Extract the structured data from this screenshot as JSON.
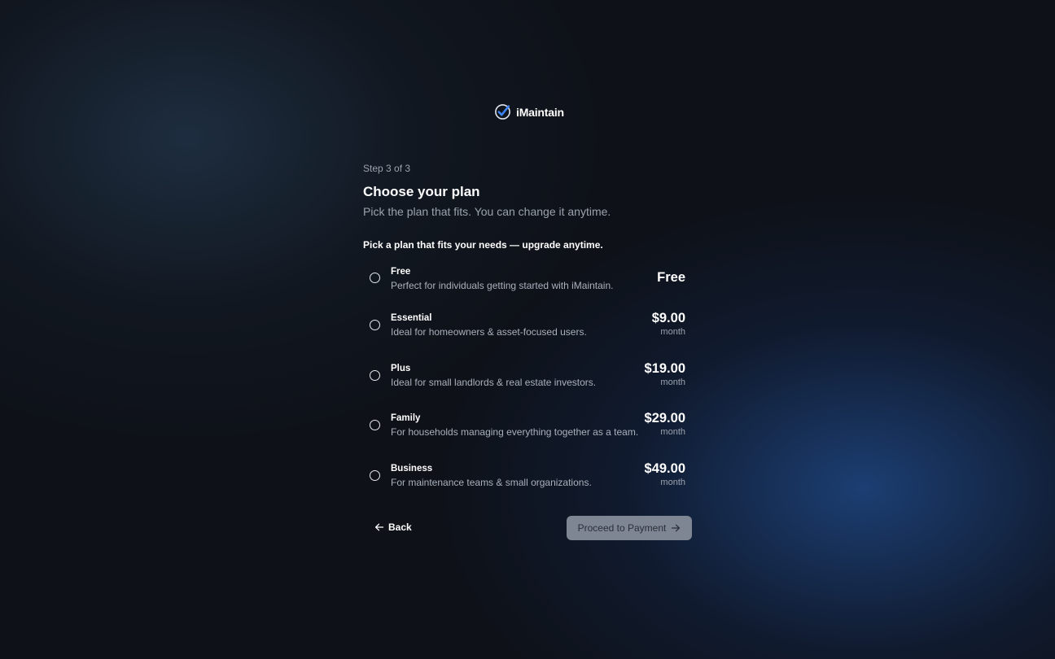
{
  "brand": {
    "name": "iMaintain",
    "logo_icon": "check-circle-icon",
    "accent": "#3b82f6"
  },
  "header": {
    "step": "Step 3 of 3",
    "title": "Choose your plan",
    "subtitle": "Pick the plan that fits. You can change it anytime."
  },
  "plans_hint": "Pick a plan that fits your needs — upgrade anytime.",
  "plans": [
    {
      "name": "Free",
      "description": "Perfect for individuals getting started with iMaintain.",
      "price": "Free",
      "period": ""
    },
    {
      "name": "Essential",
      "description": "Ideal for homeowners & asset-focused users.",
      "price": "$9.00",
      "period": "month"
    },
    {
      "name": "Plus",
      "description": "Ideal for small landlords & real estate investors.",
      "price": "$19.00",
      "period": "month"
    },
    {
      "name": "Family",
      "description": "For households managing everything together as a team.",
      "price": "$29.00",
      "period": "month"
    },
    {
      "name": "Business",
      "description": "For maintenance teams & small organizations.",
      "price": "$49.00",
      "period": "month"
    }
  ],
  "actions": {
    "back_label": "Back",
    "back_icon": "arrow-left-icon",
    "proceed_label": "Proceed to Payment",
    "proceed_icon": "arrow-right-icon"
  }
}
